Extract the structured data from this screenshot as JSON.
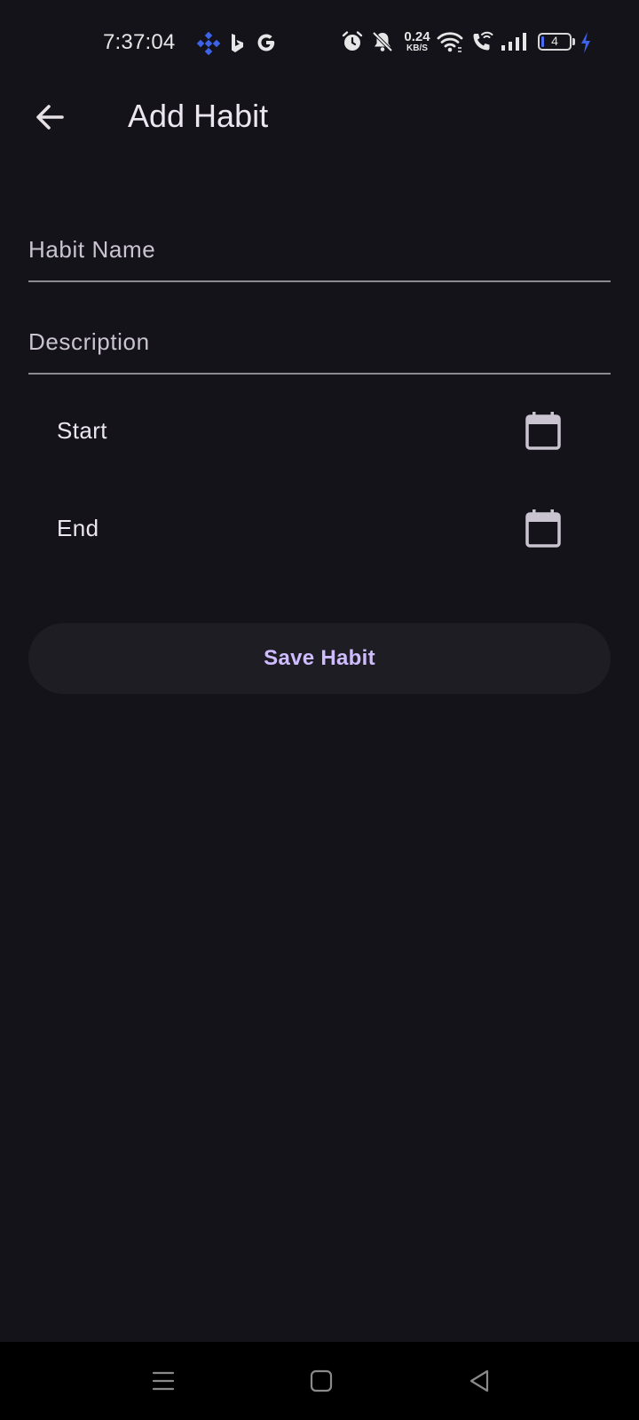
{
  "status_bar": {
    "time": "7:37:04",
    "notification_icons": [
      "binance-icon",
      "bing-icon",
      "google-icon"
    ],
    "system_icons": [
      "alarm-icon",
      "silent-bell-icon",
      "wifi-icon",
      "wifi-calling-icon",
      "signal-icon",
      "battery-icon",
      "charging-icon"
    ],
    "network_speed_value": "0.24",
    "network_speed_unit": "KB/S",
    "battery_level": "4",
    "accent_color": "#4a6cf7"
  },
  "app_bar": {
    "title": "Add Habit",
    "back_icon": "arrow-back-icon"
  },
  "form": {
    "habit_name": {
      "value": "",
      "placeholder": "Habit Name"
    },
    "description": {
      "value": "",
      "placeholder": "Description"
    },
    "start": {
      "label": "Start",
      "icon": "calendar-icon"
    },
    "end": {
      "label": "End",
      "icon": "calendar-icon"
    },
    "save_label": "Save Habit"
  },
  "nav_bar": {
    "buttons": [
      "menu-icon",
      "home-icon",
      "back-triangle-icon"
    ]
  },
  "colors": {
    "background": "#15131a",
    "primary": "#cfbcff",
    "button_surface": "#1f1d24",
    "underline": "#8e8a94"
  }
}
